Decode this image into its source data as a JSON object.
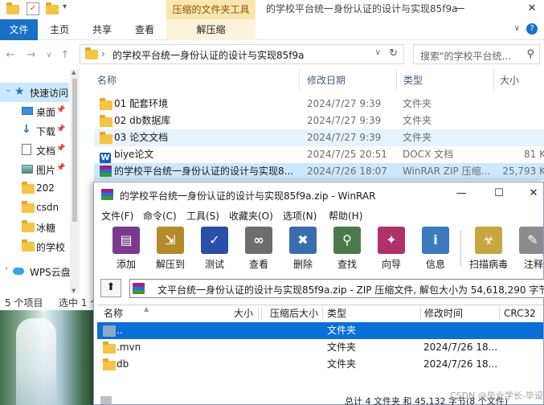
{
  "explorer": {
    "context_tab_group": "压缩的文件夹工具",
    "window_title": "的学校平台统一身份认证的设计与实现85f9a",
    "ribbon_tabs": [
      "文件",
      "主页",
      "共享",
      "查看",
      "解压缩"
    ],
    "address_path": "的学校平台统一身份认证的设计与实现85f9a",
    "search_placeholder": "搜索\"的学校平台统...",
    "nav_items": [
      {
        "label": "快速访问",
        "icon": "star-icon"
      },
      {
        "label": "桌面",
        "icon": "desktop-icon"
      },
      {
        "label": "下载",
        "icon": "download-icon"
      },
      {
        "label": "文档",
        "icon": "document-icon"
      },
      {
        "label": "图片",
        "icon": "picture-icon"
      },
      {
        "label": "202",
        "icon": "folder-icon"
      },
      {
        "label": "csdn",
        "icon": "folder-icon"
      },
      {
        "label": "冰糖",
        "icon": "folder-icon"
      },
      {
        "label": "的学校",
        "icon": "folder-icon"
      },
      {
        "label": "WPS云盘",
        "icon": "cloud-icon"
      }
    ],
    "columns": [
      "名称",
      "修改日期",
      "类型",
      "大小"
    ],
    "files": [
      {
        "name": "01 配套环境",
        "date": "2024/7/27 9:39",
        "type": "文件夹",
        "size": "",
        "icon": "folder-icon"
      },
      {
        "name": "02 db数据库",
        "date": "2024/7/27 9:39",
        "type": "文件夹",
        "size": "",
        "icon": "folder-icon"
      },
      {
        "name": "03 论文文档",
        "date": "2024/7/27 9:39",
        "type": "文件夹",
        "size": "",
        "icon": "folder-icon"
      },
      {
        "name": "biye论文",
        "date": "2024/7/25 20:51",
        "type": "DOCX 文档",
        "size": "81 K",
        "icon": "word-doc-icon"
      },
      {
        "name": "的学校平台统一身份认证的设计与实现8...",
        "date": "2024/7/26 18:07",
        "type": "WinRAR ZIP 压缩...",
        "size": "25,793 K",
        "icon": "winrar-archive-icon"
      }
    ],
    "status_items": "5 个项目",
    "status_selected": "选中 1 个"
  },
  "winrar": {
    "title": "的学校平台统一身份认证的设计与实现85f9a.zip - WinRAR",
    "menu": [
      "文件(F)",
      "命令(C)",
      "工具(S)",
      "收藏夹(O)",
      "选项(N)",
      "帮助(H)"
    ],
    "toolbar": [
      {
        "label": "添加",
        "color": "#7b3a8c"
      },
      {
        "label": "解压到",
        "color": "#b58a2a"
      },
      {
        "label": "测试",
        "color": "#2a4fa8"
      },
      {
        "label": "查看",
        "color": "#6d6d6d"
      },
      {
        "label": "删除",
        "color": "#3a6db0"
      },
      {
        "label": "查找",
        "color": "#4a7a4a"
      },
      {
        "label": "向导",
        "color": "#b0306a"
      },
      {
        "label": "信息",
        "color": "#3a7abf"
      },
      {
        "label": "扫描病毒",
        "color": "#c7a640"
      },
      {
        "label": "注释",
        "color": "#8c8c8c"
      }
    ],
    "path_text": "文平台统一身份认证的设计与实现85f9a.zip - ZIP 压缩文件, 解包大小为 54,618,290 字节",
    "columns": [
      "名称",
      "大小",
      "压缩后大小",
      "类型",
      "修改时间",
      "CRC32"
    ],
    "rows": [
      {
        "name": "..",
        "type": "文件夹",
        "mtime": "",
        "selected": true
      },
      {
        "name": ".mvn",
        "type": "文件夹",
        "mtime": "2024/7/26 18...",
        "selected": false
      },
      {
        "name": "db",
        "type": "文件夹",
        "mtime": "2024/7/26 18...",
        "selected": false
      }
    ],
    "status_text": "总计 4 文件夹 和 45,132 字节(8 个文件)"
  },
  "watermark": "CSDN @毕业学长-毕设"
}
